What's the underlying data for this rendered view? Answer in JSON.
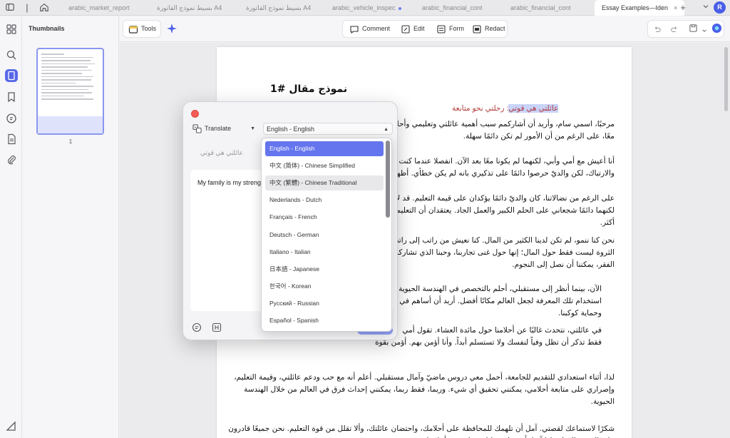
{
  "tabbar": {
    "tabs": [
      {
        "label": "arabic_market_report",
        "dot": false
      },
      {
        "label": "بسيط نموذج الفاتورة A4",
        "dot": false
      },
      {
        "label": "بسيط نموذج الفاتورة A4",
        "dot": false
      },
      {
        "label": "arabic_vehicle_inspec",
        "dot": true
      },
      {
        "label": "arabic_financial_cont",
        "dot": false
      },
      {
        "label": "arabic_financial_cont",
        "dot": false
      },
      {
        "label": "Essay Examples—Iden",
        "dot": false
      }
    ],
    "active_tab_label": "Essay Examples—Iden",
    "new_tab": "+",
    "avatar_initial": "R"
  },
  "thumbnails": {
    "title": "Thumbnails",
    "page_number": "1"
  },
  "toolbar": {
    "tools_label": "Tools",
    "comment_label": "Comment",
    "edit_label": "Edit",
    "form_label": "Form",
    "redact_label": "Redact"
  },
  "document": {
    "title": "نموذج مقال #1",
    "highlight_selected": "عائلتي هي قوتي",
    "highlight_rest": ": رحلتي نحو متابعة",
    "paragraphs": [
      "مرحبًا، اسمي سام، وأريد أن أشاركمم سبب أهمية عائلتي وتعليمي وأحلا",
      "معًا، على الرغم من أن الأمور لم تكن دائمًا سهلة.",
      "أنا أعيش مع أمي وأبي، لكنهما لم يكونا معًا بعد الآن. انفصلا عندما كنت",
      "والارتباك، لكن والديّ حرصوا دائمًا على تذكيري بانه لم يكن خطأي. أظهر",
      "على الرغم من نضالاتنا، كان والديّ دائمًا يؤكدان على قيمة التعليم. قد لا ي",
      "لكنهما دائمًا شجعاني على الحلم الكبير والعمل الجاد. يعتقدان أن التعليم",
      "أكثر.",
      "نحن كنا ننمو، لم تكن لدينا الكثير من المال. كنا نعيش من راتب إلى راتب",
      "الثروة ليست فقط حول المال؛ إنها حول غنى تجاربنا، وحبنا الذي تشاركه",
      "الفقر، يمكننا أن نصل إلى النجوم.",
      "الآن، بينما أنظر إلى مستقبلي، أحلم بالتخصص في الهندسة الحيوية.",
      "استخدام تلك المعرفة لجعل العالم مكانًا أفضل. أريد أن أساهم في",
      "وحماية كوكبنا.",
      "في عائلتي، نتحدث غالبًا عن أحلامنا حول مائدة العشاء. تقول أمي",
      "فقط تذكر أن تظل وفياً لنفسك ولا تستسلم أبداً. وأنا أؤمن بهم. أؤمن بقوة",
      "لذا، أثناء استعدادي للتقديم للجامعة، أحمل معي دروس ماضيّ وآمال مستقبلي. أعلم أنه مع حب ودعم عائلتي، وقيمة التعليم،",
      "وإصراري على متابعة أحلامي، يمكنني تحقيق أي شيء. وربما، فقط ربما، يمكنني إحداث فرق في العالم من خلال الهندسة",
      "الحيوية.",
      "شكرًا لاستماعك لقصتي. آمل أن تلهمك للمحافظة على أحلامك، واحتضان عائلتك، وألا تقلل من قوة التعليم. نحن جميعًا قادرون",
      "على الشيء العظيم إذا آمنا بأنفسنا وعملنا بجد لتحقيق أحلامنا."
    ]
  },
  "translate": {
    "mode_label": "Translate",
    "language_value": "English - English",
    "source_text": "عائلتي هي قوتي",
    "output_text": "My family is my streng",
    "dropdown_options": [
      "English - English",
      "中文 (简体) - Chinese Simplified",
      "中文 (繁體) - Chinese Traditional",
      "Nederlands - Dutch",
      "Français - French",
      "Deutsch - German",
      "Italiano - Italian",
      "日本語 - Japanese",
      "한국어 - Korean",
      "Русский - Russian",
      "Español - Spanish"
    ],
    "selected_index": 0,
    "hover_index": 2
  },
  "colors": {
    "accent": "#5867e8",
    "selected_option": "#6575ee",
    "close_dot": "#f25c55",
    "highlight_text": "#b23a3a"
  }
}
